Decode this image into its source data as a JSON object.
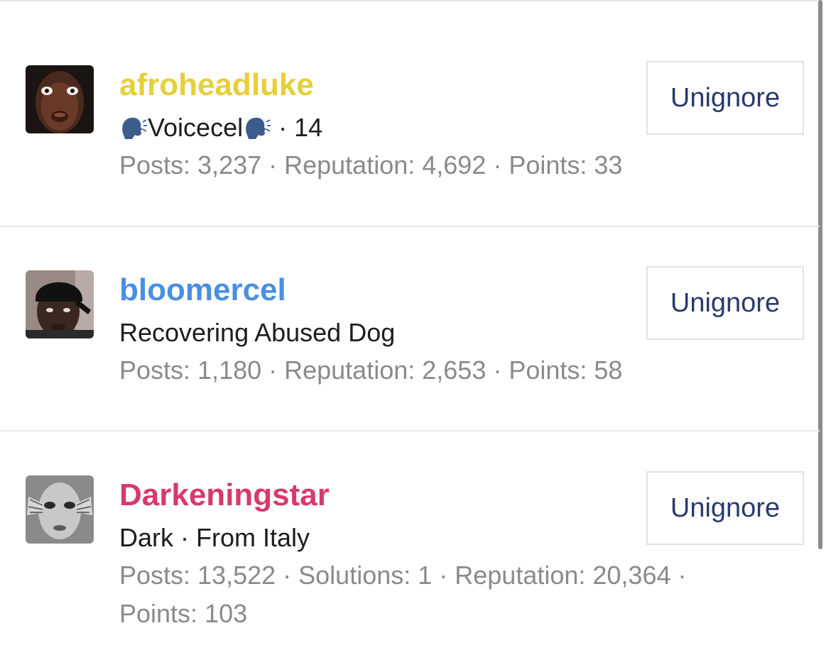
{
  "users": [
    {
      "username": "afroheadluke",
      "username_color": "#e6d03a",
      "title_text": "Voicecel",
      "title_suffix": " · 14",
      "title_icon": "speaking-head-icon",
      "stats": "Posts: 3,237 · Reputation: 4,692 · Points: 33",
      "button_label": "Unignore",
      "avatar_icon": "face-avatar-dark"
    },
    {
      "username": "bloomercel",
      "username_color": "#4a8fe0",
      "title_text": "Recovering Abused Dog",
      "stats": "Posts: 1,180 · Reputation: 2,653 · Points: 58",
      "button_label": "Unignore",
      "avatar_icon": "face-avatar-durag"
    },
    {
      "username": "Darkeningstar",
      "username_color": "#d63a6a",
      "title_text": "Dark · From Italy",
      "stats": "Posts: 13,522 · Solutions: 1 · Reputation: 20,364 ·",
      "stats_cont": "Points: 103",
      "button_label": "Unignore",
      "avatar_icon": "face-avatar-bw"
    }
  ],
  "colors": {
    "button_text": "#2a3a6b",
    "stats_text": "#8a8a8a",
    "divider": "#e6e6e6"
  }
}
